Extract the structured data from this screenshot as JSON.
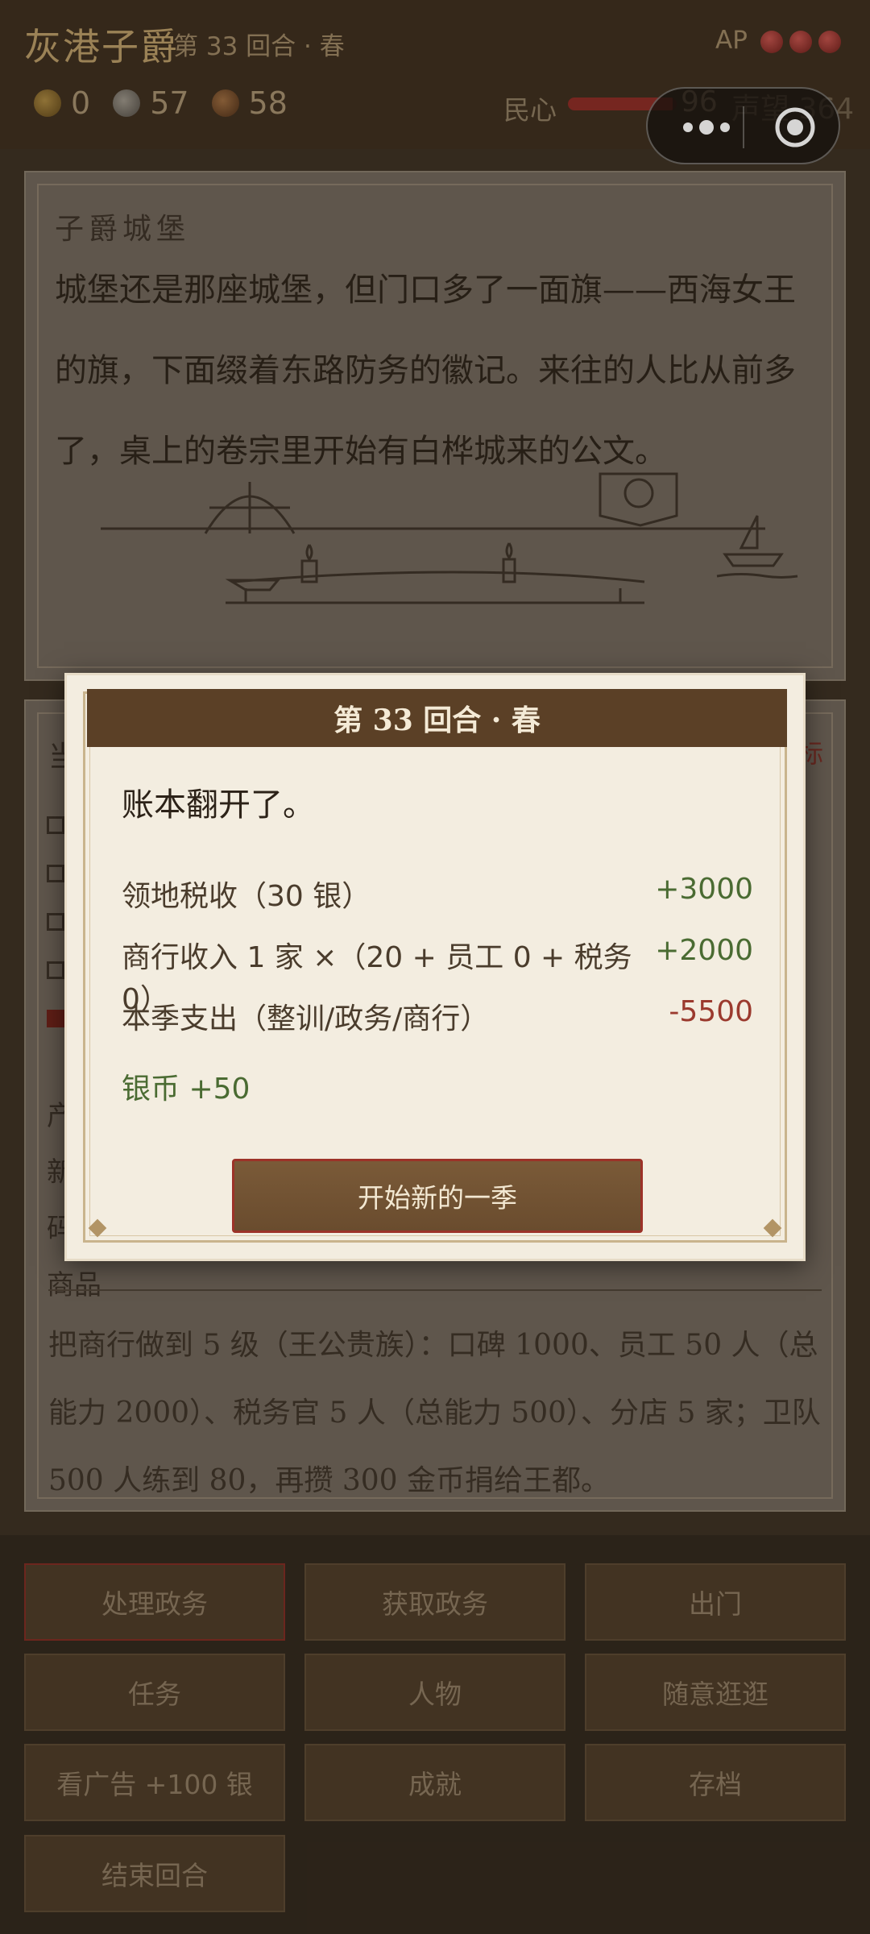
{
  "header": {
    "title": "灰港子爵",
    "turn": "第 33 回合 · 春",
    "ap_label": "AP",
    "ap_points": 3,
    "gold": "0",
    "silver": "57",
    "copper": "58",
    "minxin_label": "民心",
    "minxin_value": "96",
    "minxin_fraction": 0.96,
    "fame": "声望 364"
  },
  "scene": {
    "label": "子爵城堡",
    "text": "城堡还是那座城堡，但门口多了一面旗——西海女王的旗，下面缀着东路防务的徽记。来往的人比从前多了，桌上的卷宗里开始有白桦城来的公文。"
  },
  "status_panel": {
    "title": "当",
    "right_link": "标",
    "stat_lines": [
      "产",
      "新",
      "码",
      "商品"
    ],
    "goal_text": "把商行做到 5 级（王公贵族）：口碑 1000、员工 50 人（总能力 2000）、税务官 5 人（总能力 500）、分店 5 家；卫队 500 人练到 80，再攒 300 金币捐给王都。"
  },
  "buttons": [
    {
      "label": "处理政务",
      "name": "handle-affairs-button",
      "active": true
    },
    {
      "label": "获取政务",
      "name": "get-affairs-button",
      "active": false
    },
    {
      "label": "出门",
      "name": "go-out-button",
      "active": false
    },
    {
      "label": "任务",
      "name": "quests-button",
      "active": false
    },
    {
      "label": "人物",
      "name": "characters-button",
      "active": false
    },
    {
      "label": "随意逛逛",
      "name": "wander-button",
      "active": false
    },
    {
      "label": "看广告 +100 银",
      "name": "watch-ad-button",
      "active": false
    },
    {
      "label": "成就",
      "name": "achievements-button",
      "active": false
    },
    {
      "label": "存档",
      "name": "save-button",
      "active": false
    },
    {
      "label": "结束回合",
      "name": "end-turn-button",
      "active": false
    }
  ],
  "modal": {
    "title": "第 33 回合 · 春",
    "intro": "账本翻开了。",
    "rows": [
      {
        "label": "领地税收（30 银）",
        "amount": "+3000",
        "type": "pos"
      },
      {
        "label": "商行收入 1 家 ×（20 + 员工 0 + 税务 0）",
        "amount": "+2000",
        "type": "pos"
      },
      {
        "label": "本季支出（整训/政务/商行）",
        "amount": "-5500",
        "type": "neg"
      }
    ],
    "silver_change": "银币 +50",
    "start_button": "开始新的一季"
  },
  "colors": {
    "header_bg": "#3b2c1d",
    "modal_head": "#5b4026",
    "positive": "#4a6b32",
    "negative": "#9b3a2e",
    "accent_red": "#9c3228"
  },
  "icons": {
    "more": "more-dots-icon",
    "close": "target-close-icon",
    "coin_gold": "gold-coin-icon",
    "coin_silver": "silver-coin-icon",
    "coin_copper": "copper-coin-icon"
  }
}
